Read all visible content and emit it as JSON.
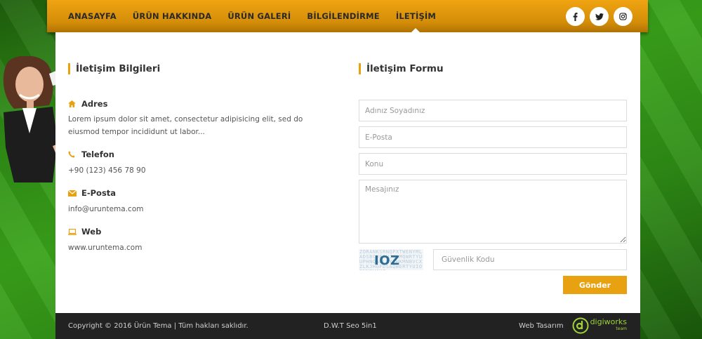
{
  "nav": {
    "items": [
      {
        "label": "ANASAYFA"
      },
      {
        "label": "ÜRÜN HAKKINDA"
      },
      {
        "label": "ÜRÜN GALERİ"
      },
      {
        "label": "BİLGİLENDİRME"
      },
      {
        "label": "İLETİŞİM"
      }
    ],
    "active_index": 4,
    "social": {
      "facebook": "f",
      "twitter": "twitter-icon",
      "instagram": "instagram-icon"
    }
  },
  "contact_info": {
    "title": "İletişim Bilgileri",
    "address": {
      "label": "Adres",
      "text": "Lorem ipsum dolor sit amet, consectetur adipisicing elit, sed do eiusmod tempor incididunt ut labor...",
      "icon": "home-icon"
    },
    "phone": {
      "label": "Telefon",
      "text": "+90 (123) 456 78 90",
      "icon": "phone-icon"
    },
    "email": {
      "label": "E-Posta",
      "text": "info@uruntema.com",
      "icon": "envelope-icon"
    },
    "web": {
      "label": "Web",
      "text": "www.uruntema.com",
      "icon": "laptop-icon"
    }
  },
  "contact_form": {
    "title": "İletişim Formu",
    "name_placeholder": "Adınız Soyadınız",
    "email_placeholder": "E-Posta",
    "subject_placeholder": "Konu",
    "message_placeholder": "Mesajınız",
    "captcha_code": "IOZ",
    "security_placeholder": "Güvenlik Kodu",
    "submit_label": "Gönder"
  },
  "footer": {
    "copyright": "Copyright © 2016 Ürün Tema | Tüm hakları saklıdır.",
    "center": "D.W.T Seo 5in1",
    "web_design_label": "Web Tasarım",
    "logo_main": "digiworks",
    "logo_sub": "team"
  },
  "colors": {
    "accent": "#e8a111",
    "nav_bg": "#d48d08",
    "footer_bg": "#222222",
    "background_green": "#2d8a14"
  }
}
